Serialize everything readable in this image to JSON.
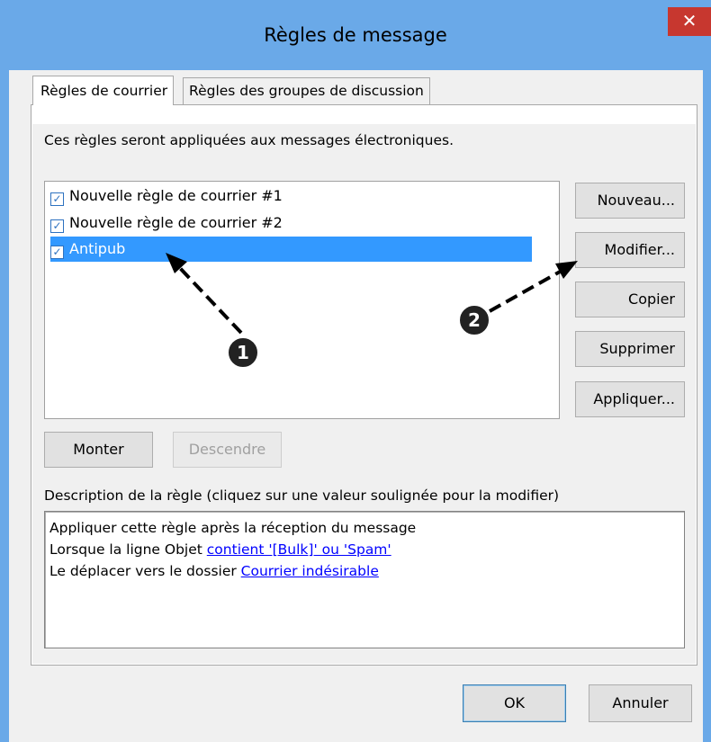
{
  "window": {
    "title": "Règles de message",
    "close_glyph": "✕"
  },
  "tabs": [
    {
      "label": "Règles de courrier",
      "active": true
    },
    {
      "label": "Règles des groupes de discussion",
      "active": false
    }
  ],
  "intro": "Ces règles seront appliquées aux messages électroniques.",
  "rules": [
    {
      "label": "Nouvelle règle de courrier #1",
      "checked": true,
      "selected": false
    },
    {
      "label": "Nouvelle règle de courrier #2",
      "checked": true,
      "selected": false
    },
    {
      "label": "Antipub",
      "checked": true,
      "selected": true
    }
  ],
  "checkbox_glyph": "✓",
  "side_buttons": {
    "new": "Nouveau...",
    "edit": "Modifier...",
    "copy": "Copier",
    "delete": "Supprimer",
    "apply": "Appliquer..."
  },
  "order_buttons": {
    "up": "Monter",
    "down": "Descendre"
  },
  "description": {
    "label": "Description de la règle (cliquez sur une valeur soulignée pour la modifier)",
    "line1": "Appliquer cette règle après la réception du message",
    "line2_prefix": "Lorsque la ligne Objet ",
    "line2_link": "contient '[Bulk]' ou 'Spam'",
    "line3_prefix": "Le déplacer vers le dossier ",
    "line3_link": "Courrier indésirable"
  },
  "dialog_buttons": {
    "ok": "OK",
    "cancel": "Annuler"
  },
  "annotations": [
    {
      "number": "1"
    },
    {
      "number": "2"
    }
  ],
  "colors": {
    "titlebar": "#6aa9e8",
    "selection": "#3399ff",
    "close": "#c7372f",
    "link": "#0000ff"
  }
}
